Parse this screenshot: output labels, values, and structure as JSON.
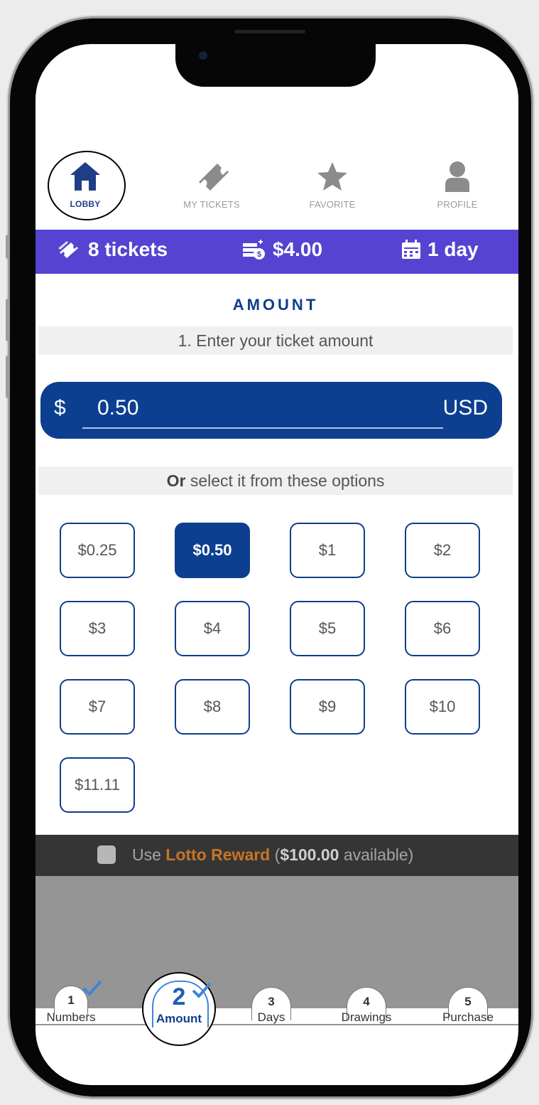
{
  "nav": {
    "items": [
      {
        "label": "LOBBY",
        "icon": "home-icon"
      },
      {
        "label": "MY TICKETS",
        "icon": "ticket-icon"
      },
      {
        "label": "FAVORITE",
        "icon": "star-icon"
      },
      {
        "label": "PROFILE",
        "icon": "user-icon"
      }
    ]
  },
  "status": {
    "tickets": "8 tickets",
    "balance": "$4.00",
    "days": "1 day"
  },
  "section": {
    "title": "AMOUNT",
    "step_instruction": "1. Enter your ticket amount",
    "currency_symbol": "$",
    "amount_value": "0.50",
    "currency": "USD",
    "options_prefix": "Or",
    "options_text": " select it from these options"
  },
  "options": [
    "$0.25",
    "$0.50",
    "$1",
    "$2",
    "$3",
    "$4",
    "$5",
    "$6",
    "$7",
    "$8",
    "$9",
    "$10",
    "$11.11"
  ],
  "selected_option": "$0.50",
  "reward": {
    "use": "Use",
    "name": "Lotto Reward",
    "open": " (",
    "amount": "$100.00",
    "rest": " available)"
  },
  "steps": [
    {
      "num": "1",
      "label": "Numbers",
      "done": true
    },
    {
      "num": "2",
      "label": "Amount",
      "done": true
    },
    {
      "num": "3",
      "label": "Days"
    },
    {
      "num": "4",
      "label": "Drawings"
    },
    {
      "num": "5",
      "label": "Purchase"
    }
  ],
  "colors": {
    "primary": "#0d3f91",
    "status_bar": "#5643d2",
    "reward_orange": "#c77525",
    "check_blue": "#3f86d8"
  }
}
